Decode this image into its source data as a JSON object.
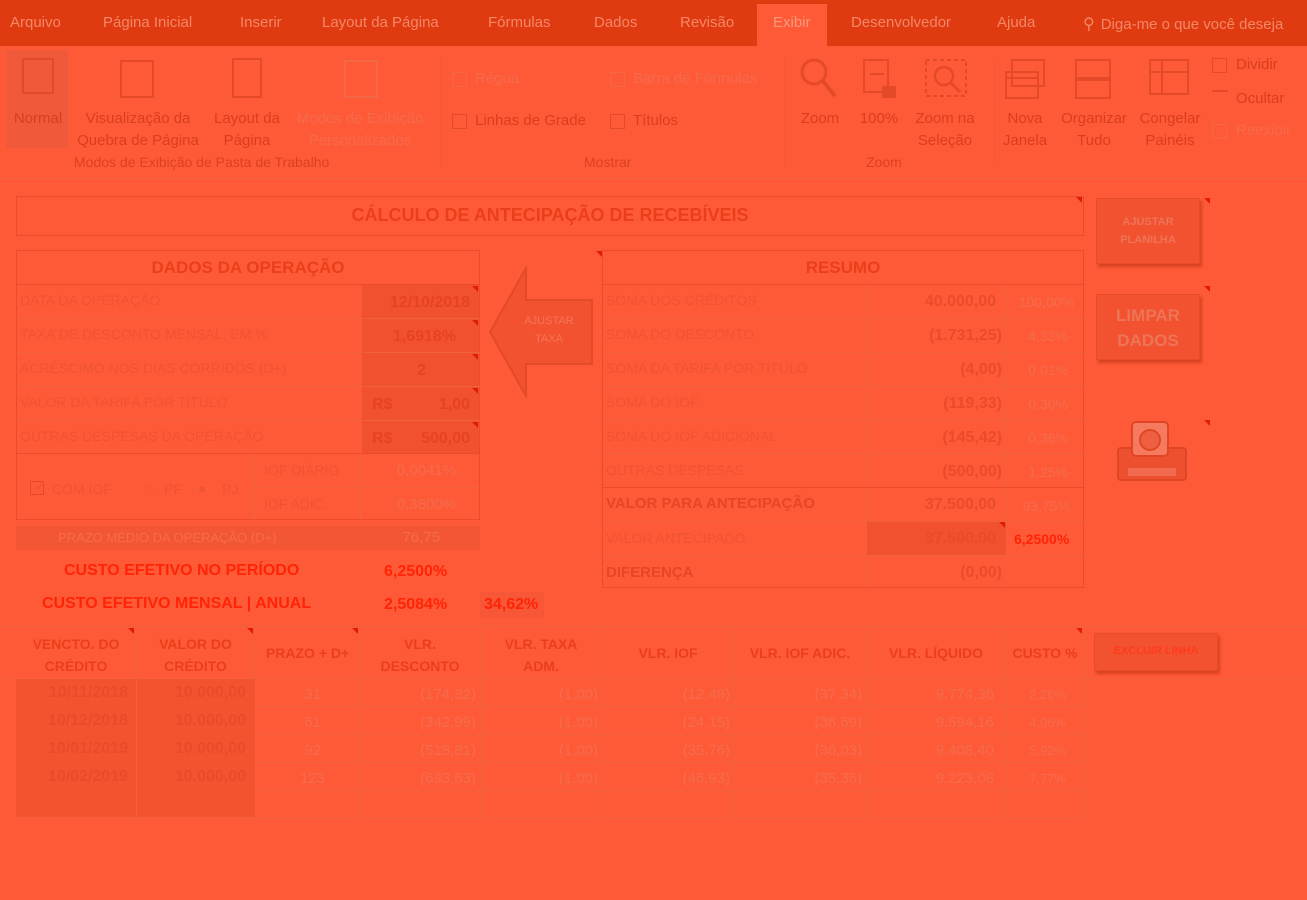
{
  "ribbon_tabs": [
    "Arquivo",
    "Página Inicial",
    "Inserir",
    "Layout da Página",
    "Fórmulas",
    "Dados",
    "Revisão",
    "Exibir",
    "Desenvolvedor",
    "Ajuda"
  ],
  "search": {
    "text": "Diga-me o que você deseja"
  },
  "ribbon": {
    "modes": {
      "normal": "Normal",
      "page_break": "Visualização da Quebra de Página",
      "layout": "Layout da Página",
      "custom": "Modos de Exibição Personalizados",
      "group": "Modos de Exibição de Pasta de Trabalho"
    },
    "show": {
      "ruler": "Régua",
      "formula_bar": "Barra de Fórmulas",
      "gridlines": "Linhas de Grade",
      "headings": "Títulos",
      "group": "Mostrar"
    },
    "zoom": {
      "zoom": "Zoom",
      "hundred": "100%",
      "selection": "Zoom na Seleção",
      "group": "Zoom"
    },
    "window": {
      "new_window": "Nova Janela",
      "arrange": "Organizar Tudo",
      "freeze": "Congelar Painéis",
      "split": "Dividir",
      "hide": "Ocultar",
      "reexibir": "Reexibir"
    }
  },
  "sheet": {
    "title": "CÁLCULO DE ANTECIPAÇÃO DE RECEBÍVEIS",
    "operation": {
      "header": "DADOS DA OPERAÇÃO",
      "rows": [
        {
          "label": "DATA DA OPERAÇÃO",
          "value": "12/10/2018"
        },
        {
          "label": "TAXA DE DESCONTO MENSAL, EM %",
          "value": "1,6918%"
        },
        {
          "label": "ACRÉSCIMO NOS DIAS CORRIDOS (D+)",
          "value": "2"
        },
        {
          "label": "VALOR DA TARIFA POR TÍTULO",
          "currency": "R$",
          "value": "1,00"
        },
        {
          "label": "OUTRAS DESPESAS DA OPERAÇÃO",
          "currency": "R$",
          "value": "500,00"
        }
      ],
      "iof_checkbox": "COM IOF",
      "pf": "PF",
      "pj": "PJ",
      "iof_diario_label": "IOF DIÁRIO",
      "iof_diario": "0,0041%",
      "iof_adic_label": "IOF ADIC.",
      "iof_adic": "0,3800%",
      "prazo_label": "PRAZO MÉDIO DA OPERAÇÃO (D+)",
      "prazo": "76,75",
      "custo_periodo_label": "CUSTO EFETIVO NO PERÍODO",
      "custo_periodo": "6,2500%",
      "custo_mensal_label": "CUSTO EFETIVO MENSAL | ANUAL",
      "custo_mensal": "2,5084%",
      "custo_anual": "34,62%"
    },
    "arrow_button": "AJUSTAR TAXA",
    "summary": {
      "header": "RESUMO",
      "rows": [
        {
          "label": "SOMA DOS CRÉDITOS",
          "value": "40.000,00",
          "pct": "100,00%"
        },
        {
          "label": "SOMA DO DESCONTO",
          "value": "(1.731,25)",
          "pct": "4,33%"
        },
        {
          "label": "SOMA DA TARIFA POR TÍTULO",
          "value": "(4,00)",
          "pct": "0,01%"
        },
        {
          "label": "SOMA DO IOF",
          "value": "(119,33)",
          "pct": "0,30%"
        },
        {
          "label": "SOMA DO IOF ADICIONAL",
          "value": "(145,42)",
          "pct": "0,36%"
        },
        {
          "label": "OUTRAS DESPESAS",
          "value": "(500,00)",
          "pct": "1,25%"
        },
        {
          "label": "VALOR PARA ANTECIPAÇÃO",
          "value": "37.500,00",
          "pct": "93,75%"
        },
        {
          "label": "VALOR ANTECIPADO",
          "value": "37.500,00",
          "pct": "6,2500%"
        },
        {
          "label": "DIFERENÇA",
          "value": "(0,00)",
          "pct": ""
        }
      ]
    },
    "buttons": {
      "ajustar": "AJUSTAR PLANILHA",
      "limpar": "LIMPAR DADOS",
      "excluir": "EXCLUIR LINHA"
    },
    "table": {
      "headers": [
        "VENCTO. DO CRÉDITO",
        "VALOR DO CRÉDITO",
        "PRAZO + D+",
        "VLR. DESCONTO",
        "VLR. TAXA ADM.",
        "VLR. IOF",
        "VLR. IOF ADIC.",
        "VLR. LÍQUIDO",
        "CUSTO %"
      ],
      "rows": [
        [
          "10/11/2018",
          "10.000,00",
          "31",
          "(174,82)",
          "(1,00)",
          "(12,49)",
          "(37,34)",
          "9.774,36",
          "2,26%"
        ],
        [
          "10/12/2018",
          "10.000,00",
          "61",
          "(342,99)",
          "(1,00)",
          "(24,15)",
          "(36,69)",
          "9.594,16",
          "4,06%"
        ],
        [
          "10/01/2019",
          "10.000,00",
          "92",
          "(518,81)",
          "(1,00)",
          "(35,76)",
          "(36,03)",
          "9.408,40",
          "5,92%"
        ],
        [
          "10/02/2019",
          "10.000,00",
          "123",
          "(693,63)",
          "(1,00)",
          "(46,93)",
          "(35,36)",
          "9.223,08",
          "7,77%"
        ]
      ]
    }
  },
  "colors": {
    "overlay": "#ff5a38",
    "tabbar": "#e03a10",
    "accent_red": "#ff2406"
  }
}
